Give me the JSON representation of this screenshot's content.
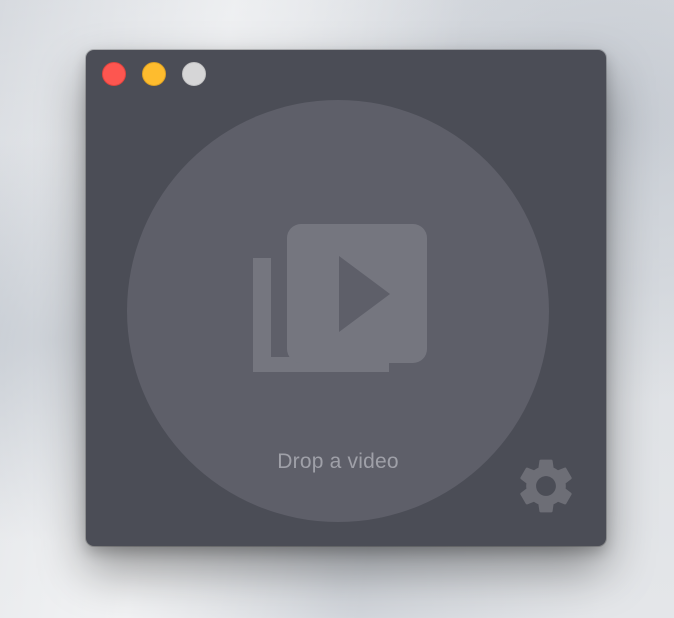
{
  "window": {
    "controls": [
      {
        "name": "close",
        "color": "#fd5650"
      },
      {
        "name": "minimize",
        "color": "#febc2e"
      },
      {
        "name": "zoom",
        "color": "#d6d6d7"
      }
    ],
    "background_color": "#4b4d56"
  },
  "drop_zone": {
    "label": "Drop a video",
    "icon": "video-library-icon",
    "circle_color": "#5e5f69",
    "icon_color": "#75767f"
  },
  "settings": {
    "icon": "gear-icon",
    "icon_color": "#6d6e76"
  }
}
